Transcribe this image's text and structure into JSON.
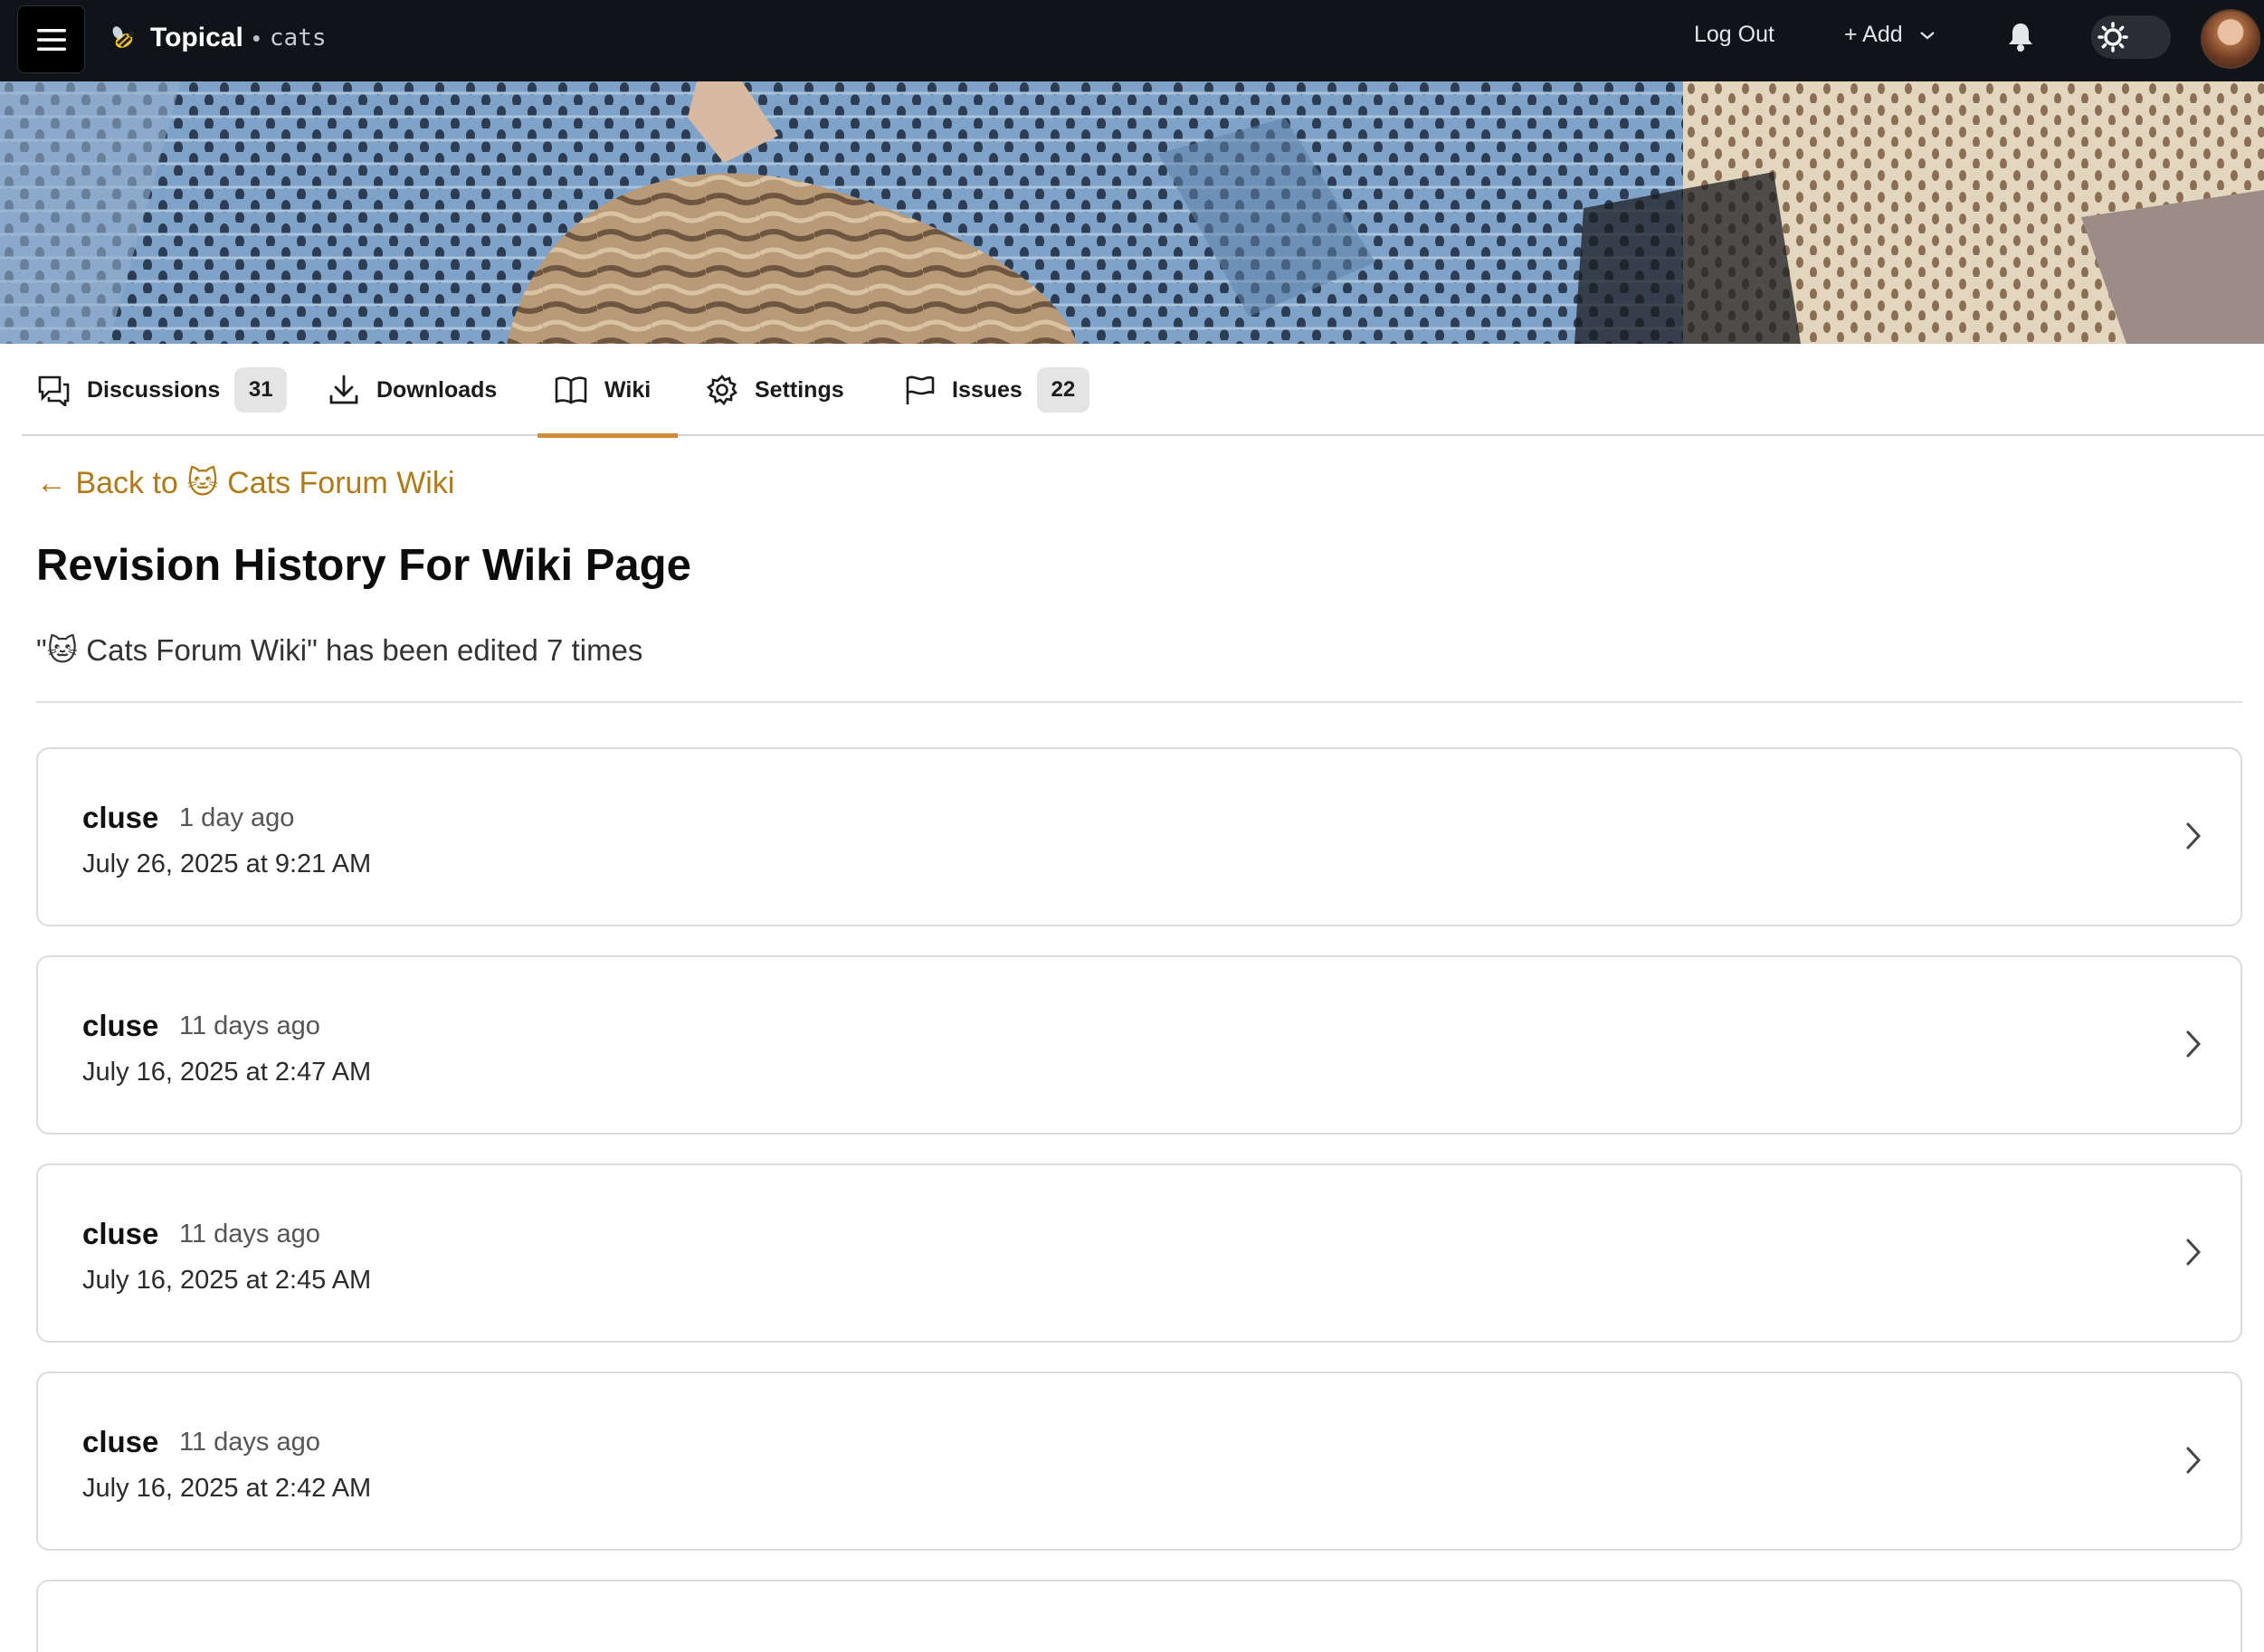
{
  "header": {
    "brand_name": "Topical",
    "brand_separator": "•",
    "brand_subtitle": "cats",
    "logout_label": "Log Out",
    "add_label": "+ Add"
  },
  "tabs": [
    {
      "label": "Discussions",
      "count": "31",
      "icon": "discussions-icon"
    },
    {
      "label": "Downloads",
      "icon": "download-icon"
    },
    {
      "label": "Wiki",
      "icon": "book-icon",
      "active": true
    },
    {
      "label": "Settings",
      "icon": "gear-icon"
    },
    {
      "label": "Issues",
      "count": "22",
      "icon": "flag-icon"
    }
  ],
  "main": {
    "back_link": "← Back to 🐱 Cats Forum Wiki",
    "title": "Revision History For Wiki Page",
    "subtitle": "\"🐱 Cats Forum Wiki\" has been edited 7 times"
  },
  "revisions": [
    {
      "user": "cluse",
      "ago": "1 day ago",
      "date": "July 26, 2025 at 9:21 AM"
    },
    {
      "user": "cluse",
      "ago": "11 days ago",
      "date": "July 16, 2025 at 2:47 AM"
    },
    {
      "user": "cluse",
      "ago": "11 days ago",
      "date": "July 16, 2025 at 2:45 AM"
    },
    {
      "user": "cluse",
      "ago": "11 days ago",
      "date": "July 16, 2025 at 2:42 AM"
    }
  ],
  "colors": {
    "nav_bg": "#101419",
    "link": "#b07a18",
    "active_tab_underline": "#d38a3a"
  }
}
